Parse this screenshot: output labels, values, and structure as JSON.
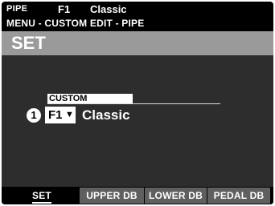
{
  "header": {
    "mode": "PIPE",
    "patch_number": "F1",
    "patch_name": "Classic",
    "path": "MENU - CUSTOM EDIT - PIPE"
  },
  "page": {
    "title": "SET"
  },
  "parameter": {
    "label": "CUSTOM",
    "marker": "1",
    "value_number": "F1",
    "value_arrow": "▼",
    "value_name": "Classic"
  },
  "tabs": [
    {
      "label": "SET",
      "active": true
    },
    {
      "label": "UPPER DB",
      "active": false
    },
    {
      "label": "LOWER DB",
      "active": false
    },
    {
      "label": "PEDAL DB",
      "active": false
    }
  ],
  "colors": {
    "title_bar": "#9a9a9a",
    "main_bg": "#2d2d2d",
    "tab_bg": "#5f5f5f"
  }
}
